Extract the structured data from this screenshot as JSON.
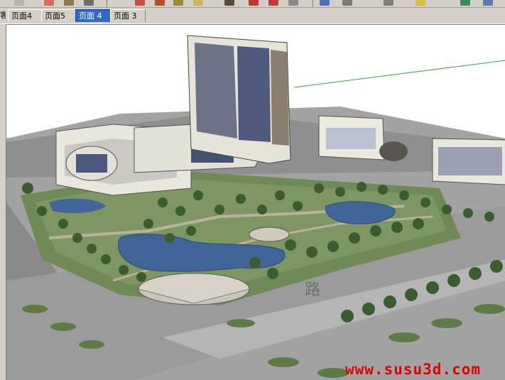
{
  "tabs": [
    {
      "label": "页面4",
      "active": false
    },
    {
      "label": "页面5",
      "active": false
    },
    {
      "label": "页面 4",
      "active": true
    },
    {
      "label": "页面 3",
      "active": false
    }
  ],
  "left_stub_text": "客",
  "watermark": "www.susu3d.com",
  "colors": {
    "ground": "#9c9c9c",
    "lawn": "#6f8a57",
    "water": "#41669a",
    "tree": "#3b5c2f",
    "building": "#e9e6dc",
    "glass": "#3f4d70",
    "accent": "#316ac5",
    "watermark": "#e00000"
  },
  "toolbar_icons": [
    "select-icon",
    "eraser-icon",
    "pencil-icon",
    "arc-icon",
    "rectangle-icon",
    "push-pull-icon",
    "move-icon",
    "rotate-icon",
    "orbit-icon",
    "pan-icon",
    "zoom-icon",
    "tape-icon",
    "paint-icon",
    "walk-icon",
    "section-icon",
    "component-icon"
  ]
}
